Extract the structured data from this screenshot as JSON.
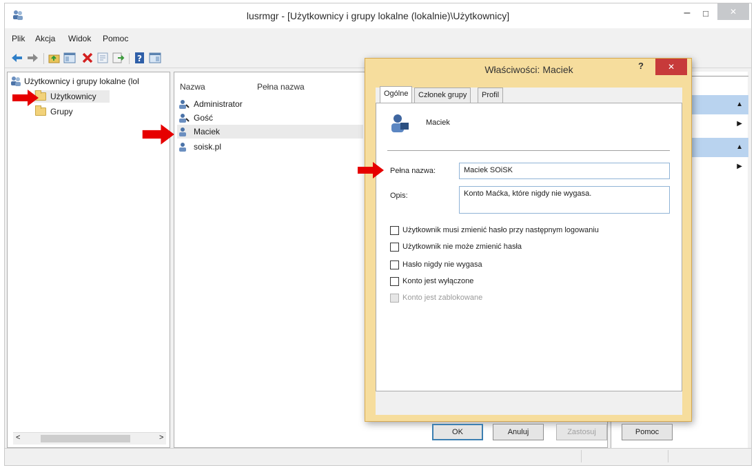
{
  "window": {
    "title": "lusrmgr - [Użytkownicy i grupy lokalne (lokalnie)\\Użytkownicy]",
    "minimize": "–",
    "maximize": "□",
    "close": "✕"
  },
  "menu": [
    "Plik",
    "Akcja",
    "Widok",
    "Pomoc"
  ],
  "toolbar_icons": [
    "back-icon",
    "forward-icon",
    "up-folder-icon",
    "show-tree-icon",
    "delete-icon",
    "properties-icon",
    "export-icon",
    "help-icon",
    "console-icon"
  ],
  "tree": {
    "root": "Użytkownicy i grupy lokalne (lol",
    "items": [
      "Użytkownicy",
      "Grupy"
    ]
  },
  "list": {
    "columns": [
      "Nazwa",
      "Pełna nazwa"
    ],
    "rows": [
      "Administrator",
      "Gość",
      "Maciek",
      "soisk.pl"
    ],
    "selected": "Maciek"
  },
  "tree_scroll": {
    "left": "<",
    "right": ">"
  },
  "dialog": {
    "title": "Właściwości: Maciek",
    "help": "?",
    "close": "✕",
    "tabs": [
      "Ogólne",
      "Członek grupy",
      "Profil"
    ],
    "active_tab": "Ogólne",
    "username": "Maciek",
    "full_name_label": "Pełna nazwa:",
    "full_name_value": "Maciek SOiSK",
    "description_label": "Opis:",
    "description_value": "Konto Maćka, które nigdy nie wygasa.",
    "checkboxes": [
      {
        "label": "Użytkownik musi zmienić hasło przy następnym logowaniu",
        "checked": false,
        "disabled": false
      },
      {
        "label": "Użytkownik nie może zmienić hasła",
        "checked": false,
        "disabled": false
      },
      {
        "label": "Hasło nigdy nie wygasa",
        "checked": false,
        "disabled": false
      },
      {
        "label": "Konto jest wyłączone",
        "checked": false,
        "disabled": false
      },
      {
        "label": "Konto jest zablokowane",
        "checked": false,
        "disabled": true
      }
    ],
    "buttons": {
      "ok": "OK",
      "cancel": "Anuluj",
      "apply": "Zastosuj",
      "help": "Pomoc"
    }
  },
  "colors": {
    "accent": "#b9d3ef",
    "dialog_frame": "#f6dd9d",
    "close_red": "#c73a3a",
    "annotation_arrow": "#e60000"
  }
}
